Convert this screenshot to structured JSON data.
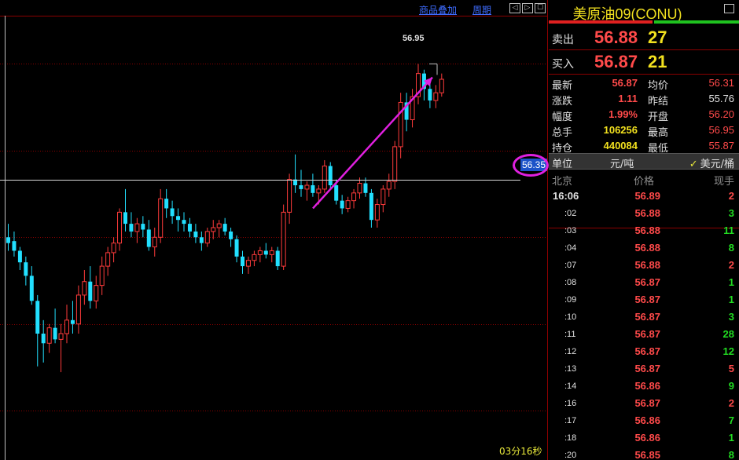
{
  "toolbar": {
    "overlay_label": "商品叠加",
    "period_label": "周期",
    "nav_prev": "◁",
    "nav_next": "▷",
    "nav_fit": "☐"
  },
  "chart": {
    "peak_label": "56.95",
    "crosshair_price": "56.35",
    "timer": "03分16秒",
    "colors": {
      "up": "#ff3b3b",
      "down": "#22e0ff",
      "grid": "#8b0000",
      "arrow": "#e020e0"
    }
  },
  "chart_data": {
    "type": "candlestick",
    "title": "",
    "xlabel": "",
    "ylabel": "",
    "ylim": [
      55.0,
      57.2
    ],
    "candles": [
      {
        "o": 56.05,
        "h": 56.12,
        "l": 55.98,
        "c": 56.02
      },
      {
        "o": 56.03,
        "h": 56.08,
        "l": 55.95,
        "c": 55.98
      },
      {
        "o": 55.98,
        "h": 56.0,
        "l": 55.88,
        "c": 55.92
      },
      {
        "o": 55.92,
        "h": 55.95,
        "l": 55.8,
        "c": 55.85
      },
      {
        "o": 55.85,
        "h": 55.9,
        "l": 55.7,
        "c": 55.72
      },
      {
        "o": 55.72,
        "h": 55.75,
        "l": 55.38,
        "c": 55.55
      },
      {
        "o": 55.55,
        "h": 55.62,
        "l": 55.4,
        "c": 55.5
      },
      {
        "o": 55.5,
        "h": 55.6,
        "l": 55.45,
        "c": 55.58
      },
      {
        "o": 55.58,
        "h": 55.68,
        "l": 55.5,
        "c": 55.52
      },
      {
        "o": 55.52,
        "h": 55.6,
        "l": 55.35,
        "c": 55.55
      },
      {
        "o": 55.55,
        "h": 55.7,
        "l": 55.5,
        "c": 55.62
      },
      {
        "o": 55.62,
        "h": 55.72,
        "l": 55.55,
        "c": 55.6
      },
      {
        "o": 55.6,
        "h": 55.8,
        "l": 55.55,
        "c": 55.75
      },
      {
        "o": 55.75,
        "h": 55.88,
        "l": 55.7,
        "c": 55.82
      },
      {
        "o": 55.82,
        "h": 55.9,
        "l": 55.68,
        "c": 55.72
      },
      {
        "o": 55.72,
        "h": 55.85,
        "l": 55.68,
        "c": 55.8
      },
      {
        "o": 55.8,
        "h": 55.95,
        "l": 55.75,
        "c": 55.9
      },
      {
        "o": 55.9,
        "h": 56.0,
        "l": 55.85,
        "c": 55.97
      },
      {
        "o": 55.97,
        "h": 56.05,
        "l": 55.92,
        "c": 56.02
      },
      {
        "o": 56.02,
        "h": 56.2,
        "l": 55.98,
        "c": 56.18
      },
      {
        "o": 56.18,
        "h": 56.3,
        "l": 56.08,
        "c": 56.12
      },
      {
        "o": 56.12,
        "h": 56.18,
        "l": 56.05,
        "c": 56.08
      },
      {
        "o": 56.08,
        "h": 56.15,
        "l": 56.02,
        "c": 56.12
      },
      {
        "o": 56.12,
        "h": 56.16,
        "l": 56.05,
        "c": 56.09
      },
      {
        "o": 56.09,
        "h": 56.14,
        "l": 55.98,
        "c": 56.0
      },
      {
        "o": 56.0,
        "h": 56.1,
        "l": 55.95,
        "c": 56.05
      },
      {
        "o": 56.05,
        "h": 56.3,
        "l": 56.02,
        "c": 56.25
      },
      {
        "o": 56.25,
        "h": 56.3,
        "l": 56.15,
        "c": 56.2
      },
      {
        "o": 56.2,
        "h": 56.24,
        "l": 56.12,
        "c": 56.16
      },
      {
        "o": 56.16,
        "h": 56.2,
        "l": 56.08,
        "c": 56.14
      },
      {
        "o": 56.14,
        "h": 56.18,
        "l": 56.08,
        "c": 56.12
      },
      {
        "o": 56.12,
        "h": 56.15,
        "l": 56.05,
        "c": 56.08
      },
      {
        "o": 56.08,
        "h": 56.12,
        "l": 56.02,
        "c": 56.05
      },
      {
        "o": 56.05,
        "h": 56.08,
        "l": 55.98,
        "c": 56.02
      },
      {
        "o": 56.02,
        "h": 56.1,
        "l": 56.0,
        "c": 56.08
      },
      {
        "o": 56.08,
        "h": 56.14,
        "l": 56.04,
        "c": 56.1
      },
      {
        "o": 56.1,
        "h": 56.14,
        "l": 56.05,
        "c": 56.12
      },
      {
        "o": 56.12,
        "h": 56.15,
        "l": 56.06,
        "c": 56.08
      },
      {
        "o": 56.08,
        "h": 56.1,
        "l": 56.0,
        "c": 56.04
      },
      {
        "o": 56.04,
        "h": 56.06,
        "l": 55.92,
        "c": 55.95
      },
      {
        "o": 55.95,
        "h": 55.98,
        "l": 55.86,
        "c": 55.9
      },
      {
        "o": 55.9,
        "h": 55.95,
        "l": 55.86,
        "c": 55.93
      },
      {
        "o": 55.93,
        "h": 55.98,
        "l": 55.9,
        "c": 55.96
      },
      {
        "o": 55.96,
        "h": 56.0,
        "l": 55.92,
        "c": 55.98
      },
      {
        "o": 55.98,
        "h": 56.02,
        "l": 55.94,
        "c": 55.96
      },
      {
        "o": 55.96,
        "h": 56.0,
        "l": 55.92,
        "c": 55.98
      },
      {
        "o": 55.98,
        "h": 56.0,
        "l": 55.88,
        "c": 55.9
      },
      {
        "o": 55.9,
        "h": 56.22,
        "l": 55.88,
        "c": 56.18
      },
      {
        "o": 56.18,
        "h": 56.38,
        "l": 56.12,
        "c": 56.35
      },
      {
        "o": 56.35,
        "h": 56.48,
        "l": 56.28,
        "c": 56.32
      },
      {
        "o": 56.32,
        "h": 56.4,
        "l": 56.26,
        "c": 56.3
      },
      {
        "o": 56.3,
        "h": 56.34,
        "l": 56.24,
        "c": 56.32
      },
      {
        "o": 56.32,
        "h": 56.38,
        "l": 56.26,
        "c": 56.28
      },
      {
        "o": 56.28,
        "h": 56.32,
        "l": 56.22,
        "c": 56.3
      },
      {
        "o": 56.3,
        "h": 56.45,
        "l": 56.28,
        "c": 56.42
      },
      {
        "o": 56.42,
        "h": 56.44,
        "l": 56.3,
        "c": 56.32
      },
      {
        "o": 56.32,
        "h": 56.35,
        "l": 56.22,
        "c": 56.24
      },
      {
        "o": 56.24,
        "h": 56.27,
        "l": 56.17,
        "c": 56.2
      },
      {
        "o": 56.2,
        "h": 56.26,
        "l": 56.18,
        "c": 56.24
      },
      {
        "o": 56.24,
        "h": 56.3,
        "l": 56.2,
        "c": 56.28
      },
      {
        "o": 56.28,
        "h": 56.36,
        "l": 56.25,
        "c": 56.33
      },
      {
        "o": 56.33,
        "h": 56.36,
        "l": 56.26,
        "c": 56.28
      },
      {
        "o": 56.28,
        "h": 56.3,
        "l": 56.1,
        "c": 56.14
      },
      {
        "o": 56.14,
        "h": 56.25,
        "l": 56.1,
        "c": 56.22
      },
      {
        "o": 56.22,
        "h": 56.32,
        "l": 56.18,
        "c": 56.3
      },
      {
        "o": 56.3,
        "h": 56.38,
        "l": 56.26,
        "c": 56.34
      },
      {
        "o": 56.34,
        "h": 56.55,
        "l": 56.3,
        "c": 56.52
      },
      {
        "o": 56.52,
        "h": 56.8,
        "l": 56.46,
        "c": 56.75
      },
      {
        "o": 56.75,
        "h": 56.8,
        "l": 56.6,
        "c": 56.66
      },
      {
        "o": 56.66,
        "h": 56.82,
        "l": 56.62,
        "c": 56.78
      },
      {
        "o": 56.78,
        "h": 56.95,
        "l": 56.74,
        "c": 56.9
      },
      {
        "o": 56.9,
        "h": 56.92,
        "l": 56.76,
        "c": 56.82
      },
      {
        "o": 56.82,
        "h": 56.86,
        "l": 56.72,
        "c": 56.76
      },
      {
        "o": 56.76,
        "h": 56.84,
        "l": 56.72,
        "c": 56.8
      },
      {
        "o": 56.8,
        "h": 56.9,
        "l": 56.78,
        "c": 56.87
      }
    ]
  },
  "panel": {
    "title": "美原油09(CONU)",
    "sell": {
      "label": "卖出",
      "price": "56.88",
      "volume": "27"
    },
    "buy": {
      "label": "买入",
      "price": "56.87",
      "volume": "21"
    },
    "stats": [
      {
        "label": "最新",
        "value": "56.87",
        "color": "#ff4a4a",
        "col": 0,
        "row": 0
      },
      {
        "label": "均价",
        "value": "56.31",
        "color": "#ff4a4a",
        "col": 1,
        "row": 0
      },
      {
        "label": "涨跌",
        "value": "1.11",
        "color": "#ff4a4a",
        "col": 0,
        "row": 1
      },
      {
        "label": "昨结",
        "value": "55.76",
        "color": "#e0e0e0",
        "col": 1,
        "row": 1
      },
      {
        "label": "幅度",
        "value": "1.99%",
        "color": "#ff4a4a",
        "col": 0,
        "row": 2
      },
      {
        "label": "开盘",
        "value": "56.20",
        "color": "#ff4a4a",
        "col": 1,
        "row": 2
      },
      {
        "label": "总手",
        "value": "106256",
        "color": "#f2e11f",
        "col": 0,
        "row": 3
      },
      {
        "label": "最高",
        "value": "56.95",
        "color": "#ff4a4a",
        "col": 1,
        "row": 3
      },
      {
        "label": "持仓",
        "value": "440084",
        "color": "#f2e11f",
        "col": 0,
        "row": 4
      },
      {
        "label": "最低",
        "value": "55.87",
        "color": "#ff4a4a",
        "col": 1,
        "row": 4
      }
    ],
    "unit": {
      "label": "单位",
      "ton": "元/吨",
      "check": "✓",
      "barrel": "美元/桶"
    },
    "tick_header": {
      "time": "北京",
      "price": "价格",
      "volume": "现手"
    },
    "ticks": [
      {
        "time": "16:06",
        "price": "56.89",
        "volume": "2",
        "vcolor": "#ff4a4a",
        "main": true
      },
      {
        "time": ":02",
        "price": "56.88",
        "volume": "3",
        "vcolor": "#22dd22"
      },
      {
        "time": ":03",
        "price": "56.88",
        "volume": "11",
        "vcolor": "#22dd22"
      },
      {
        "time": ":04",
        "price": "56.88",
        "volume": "8",
        "vcolor": "#22dd22"
      },
      {
        "time": ":07",
        "price": "56.88",
        "volume": "2",
        "vcolor": "#ff4a4a"
      },
      {
        "time": ":08",
        "price": "56.87",
        "volume": "1",
        "vcolor": "#22dd22"
      },
      {
        "time": ":09",
        "price": "56.87",
        "volume": "1",
        "vcolor": "#22dd22"
      },
      {
        "time": ":10",
        "price": "56.87",
        "volume": "3",
        "vcolor": "#22dd22"
      },
      {
        "time": ":11",
        "price": "56.87",
        "volume": "28",
        "vcolor": "#22dd22"
      },
      {
        "time": ":12",
        "price": "56.87",
        "volume": "12",
        "vcolor": "#22dd22"
      },
      {
        "time": ":13",
        "price": "56.87",
        "volume": "5",
        "vcolor": "#ff4a4a"
      },
      {
        "time": ":14",
        "price": "56.86",
        "volume": "9",
        "vcolor": "#22dd22"
      },
      {
        "time": ":16",
        "price": "56.87",
        "volume": "2",
        "vcolor": "#ff4a4a"
      },
      {
        "time": ":17",
        "price": "56.86",
        "volume": "7",
        "vcolor": "#22dd22"
      },
      {
        "time": ":18",
        "price": "56.86",
        "volume": "1",
        "vcolor": "#22dd22"
      },
      {
        "time": ":20",
        "price": "56.85",
        "volume": "8",
        "vcolor": "#22dd22"
      }
    ]
  }
}
